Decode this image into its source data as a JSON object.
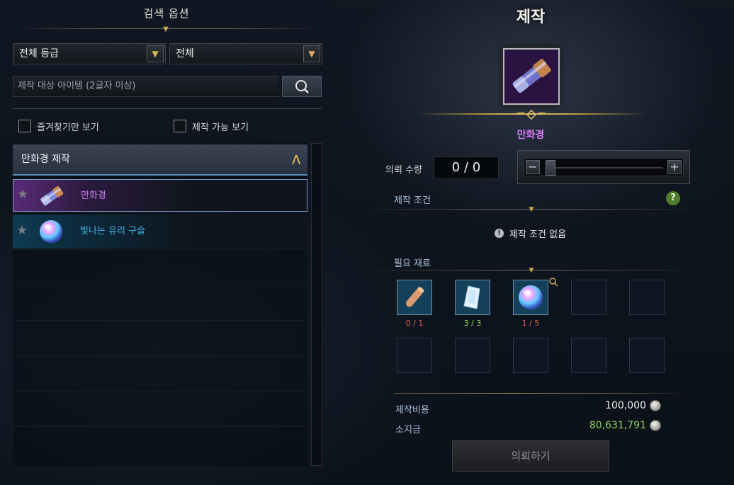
{
  "search": {
    "header": "검색 옵션",
    "grade_select": "전체 등급",
    "type_select": "전체",
    "placeholder": "제작 대상 아이템 (2글자 이상)",
    "favorites_only": "즐겨찾기만 보기",
    "craftable_only": "제작 가능 보기"
  },
  "list": {
    "group_title": "만화경 제작",
    "items": [
      {
        "name": "만화경",
        "rarity_color": "#d57bf2"
      },
      {
        "name": "빛나는 유리 구슬",
        "rarity_color": "#3fb8f0"
      }
    ]
  },
  "craft": {
    "title": "제작",
    "item_name": "만화경",
    "qty_label": "의뢰 수량",
    "qty_value": "0 / 0",
    "slider_minus": "−",
    "slider_plus": "+",
    "conditions_label": "제작 조건",
    "help": "?",
    "no_conditions": "제작 조건 없음",
    "materials_label": "필요 재료",
    "materials": [
      {
        "icon": "scroll-roll-icon",
        "count": "0 / 1",
        "status": "insufficient"
      },
      {
        "icon": "glass-shard-icon",
        "count": "3 / 3",
        "status": "ok"
      },
      {
        "icon": "glowing-orb-icon",
        "count": "1 / 5",
        "status": "insufficient"
      }
    ],
    "cost_label": "제작비용",
    "cost_value": "100,000",
    "owned_label": "소지금",
    "owned_value": "80,631,791",
    "request_button": "의뢰하기"
  },
  "colors": {
    "accent_gold": "#c9a756",
    "insufficient": "#e35a4b",
    "sufficient": "#8fd15a",
    "label_blue": "#a9c3dc"
  }
}
